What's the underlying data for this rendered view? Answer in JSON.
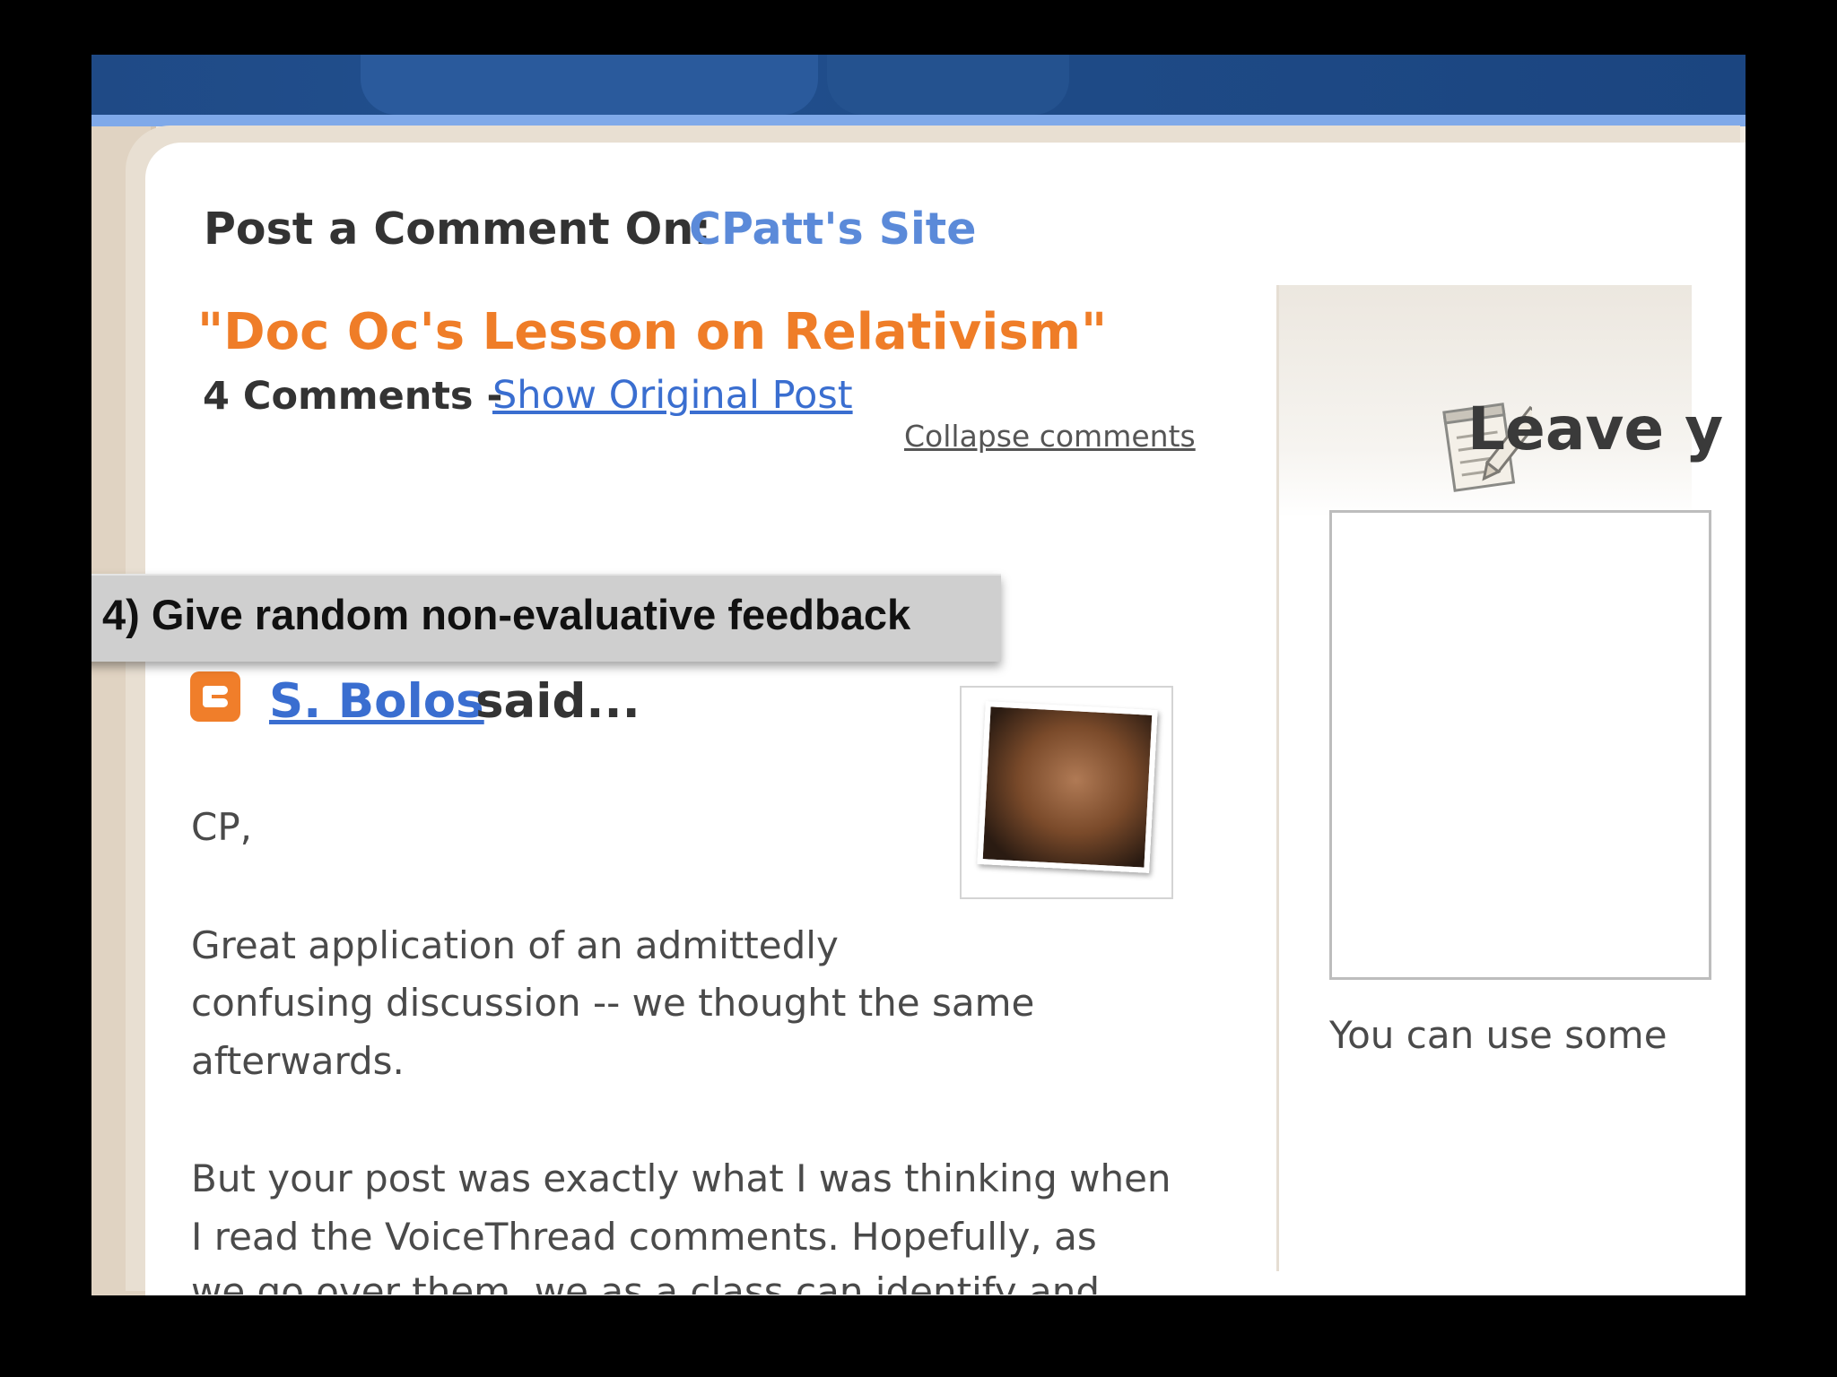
{
  "header": {
    "post_comment_label": "Post a Comment On:",
    "site_name": "CPatt's Site"
  },
  "post": {
    "title": "\"Doc Oc's Lesson on Relativism\"",
    "comment_count": "4 Comments -",
    "show_original_label": "Show Original Post",
    "collapse_label": "Collapse comments"
  },
  "callout": {
    "text": "4) Give random non-evaluative feedback"
  },
  "comment": {
    "author": "S. Bolos",
    "said": "said...",
    "lines": [
      "CP,",
      "Great application of an admittedly",
      "confusing discussion -- we thought the same",
      "afterwards.",
      "But your post was exactly what I was thinking when",
      "I read the VoiceThread comments. Hopefully, as",
      "we go over them, we as a class can identify and"
    ]
  },
  "right_panel": {
    "heading": "Leave y",
    "note": "You can use some"
  },
  "icons": {
    "blogger": "blogger-icon",
    "avatar": "commenter-avatar",
    "notepad": "notepad-pencil-icon"
  },
  "colors": {
    "link_blue": "#3a6ed0",
    "site_blue": "#5b8ad9",
    "title_orange": "#ef7d28",
    "top_bar": "#1f4a86"
  }
}
